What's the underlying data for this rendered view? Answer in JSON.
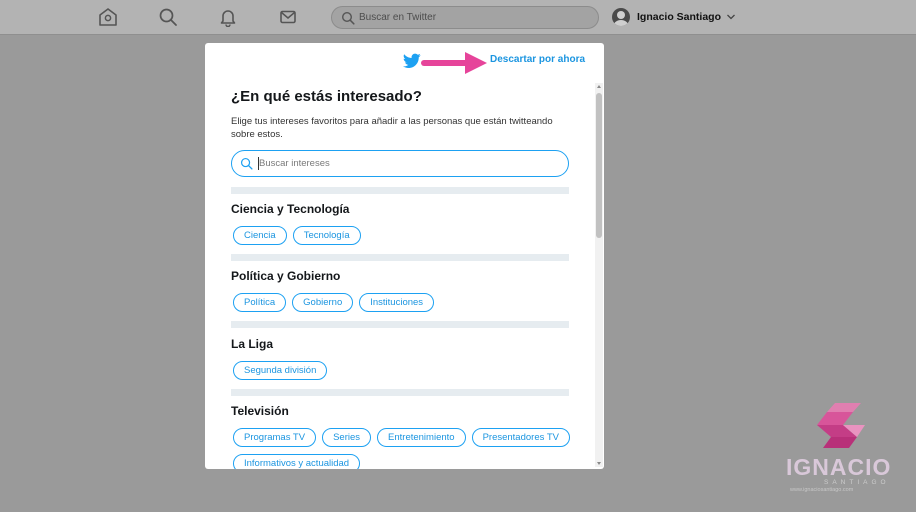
{
  "nav": {
    "icons": [
      "home-icon",
      "explore-icon",
      "notifications-icon",
      "messages-icon"
    ],
    "search_placeholder": "Buscar en Twitter",
    "username": "Ignacio Santiago"
  },
  "modal": {
    "dismiss_label": "Descartar por ahora",
    "title": "¿En qué estás interesado?",
    "subtitle": "Elige tus intereses favoritos para añadir a las personas que están twitteando sobre estos.",
    "search_placeholder": "Buscar intereses",
    "accent_color": "#1da1f2",
    "arrow_color": "#e6449a",
    "categories": [
      {
        "title": "Ciencia y Tecnología",
        "chips": [
          "Ciencia",
          "Tecnología"
        ]
      },
      {
        "title": "Política y Gobierno",
        "chips": [
          "Política",
          "Gobierno",
          "Instituciones"
        ]
      },
      {
        "title": "La Liga",
        "chips": [
          "Segunda división"
        ]
      },
      {
        "title": "Televisión",
        "chips": [
          "Programas TV",
          "Series",
          "Entretenimiento",
          "Presentadores TV",
          "Informativos y actualidad"
        ]
      }
    ]
  },
  "watermark": {
    "name": "IGNACIO",
    "sub": "SANTIAGO",
    "url": "www.ignaciosantiago.com"
  }
}
